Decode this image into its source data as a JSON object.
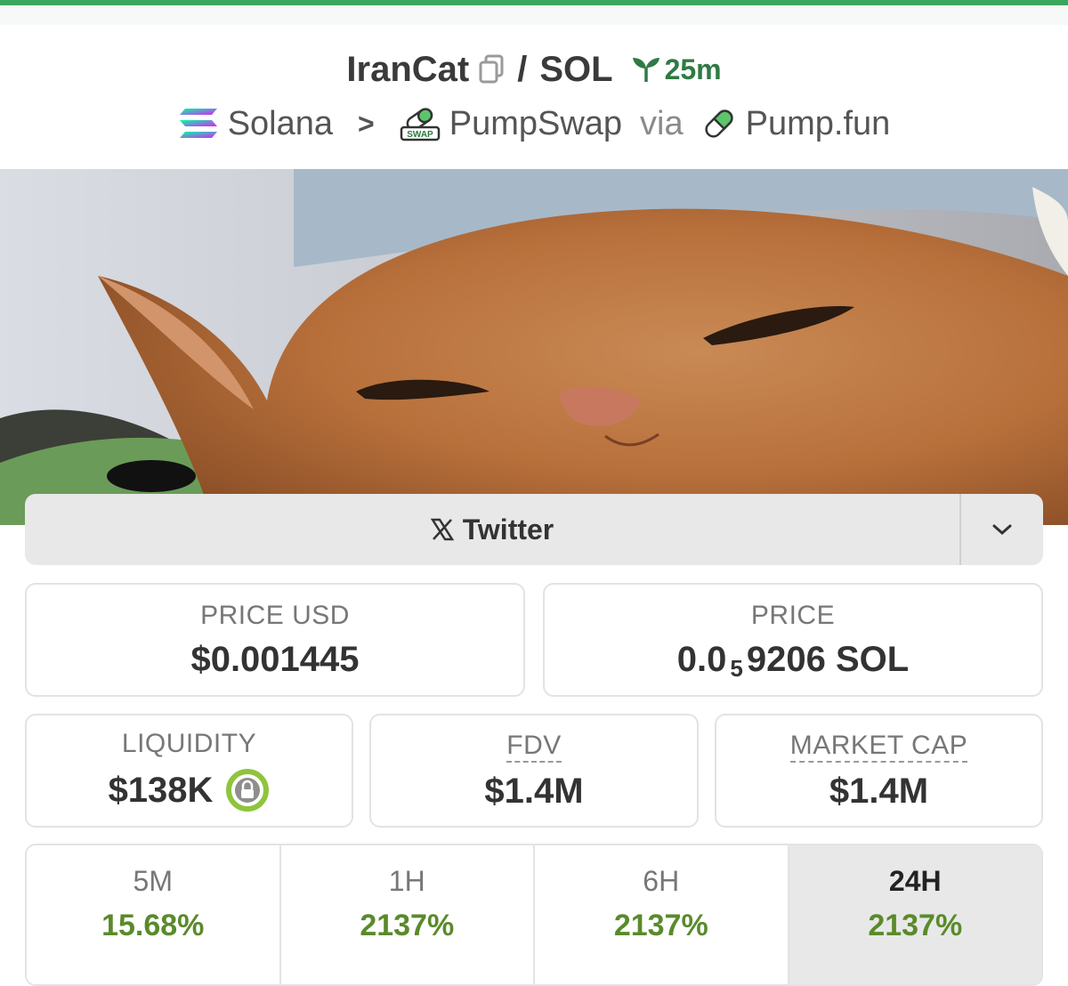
{
  "colors": {
    "accent_green": "#3aa55d",
    "positive": "#5a8a2b",
    "age_green": "#2f7a44"
  },
  "header": {
    "token": "IranCat",
    "quote": "SOL",
    "separator": "/",
    "age": "25m",
    "chain": "Solana",
    "dex": "PumpSwap",
    "via": "via",
    "launchpad": "Pump.fun"
  },
  "socials": {
    "twitter_label": "Twitter"
  },
  "stats": {
    "price_usd_label": "PRICE USD",
    "price_usd": "$0.001445",
    "price_label": "PRICE",
    "price_prefix": "0.0",
    "price_zeros": "5",
    "price_suffix": "9206 SOL",
    "liquidity_label": "LIQUIDITY",
    "liquidity": "$138K",
    "fdv_label": "FDV",
    "fdv": "$1.4M",
    "mcap_label": "MARKET CAP",
    "mcap": "$1.4M"
  },
  "timeframes": [
    {
      "label": "5M",
      "change": "15.68%"
    },
    {
      "label": "1H",
      "change": "2137%"
    },
    {
      "label": "6H",
      "change": "2137%"
    },
    {
      "label": "24H",
      "change": "2137%"
    }
  ],
  "icons": [
    "copy-icon",
    "sprout-icon",
    "solana-icon",
    "pumpswap-icon",
    "pill-icon",
    "x-logo-icon",
    "chevron-down-icon",
    "lock-icon"
  ]
}
